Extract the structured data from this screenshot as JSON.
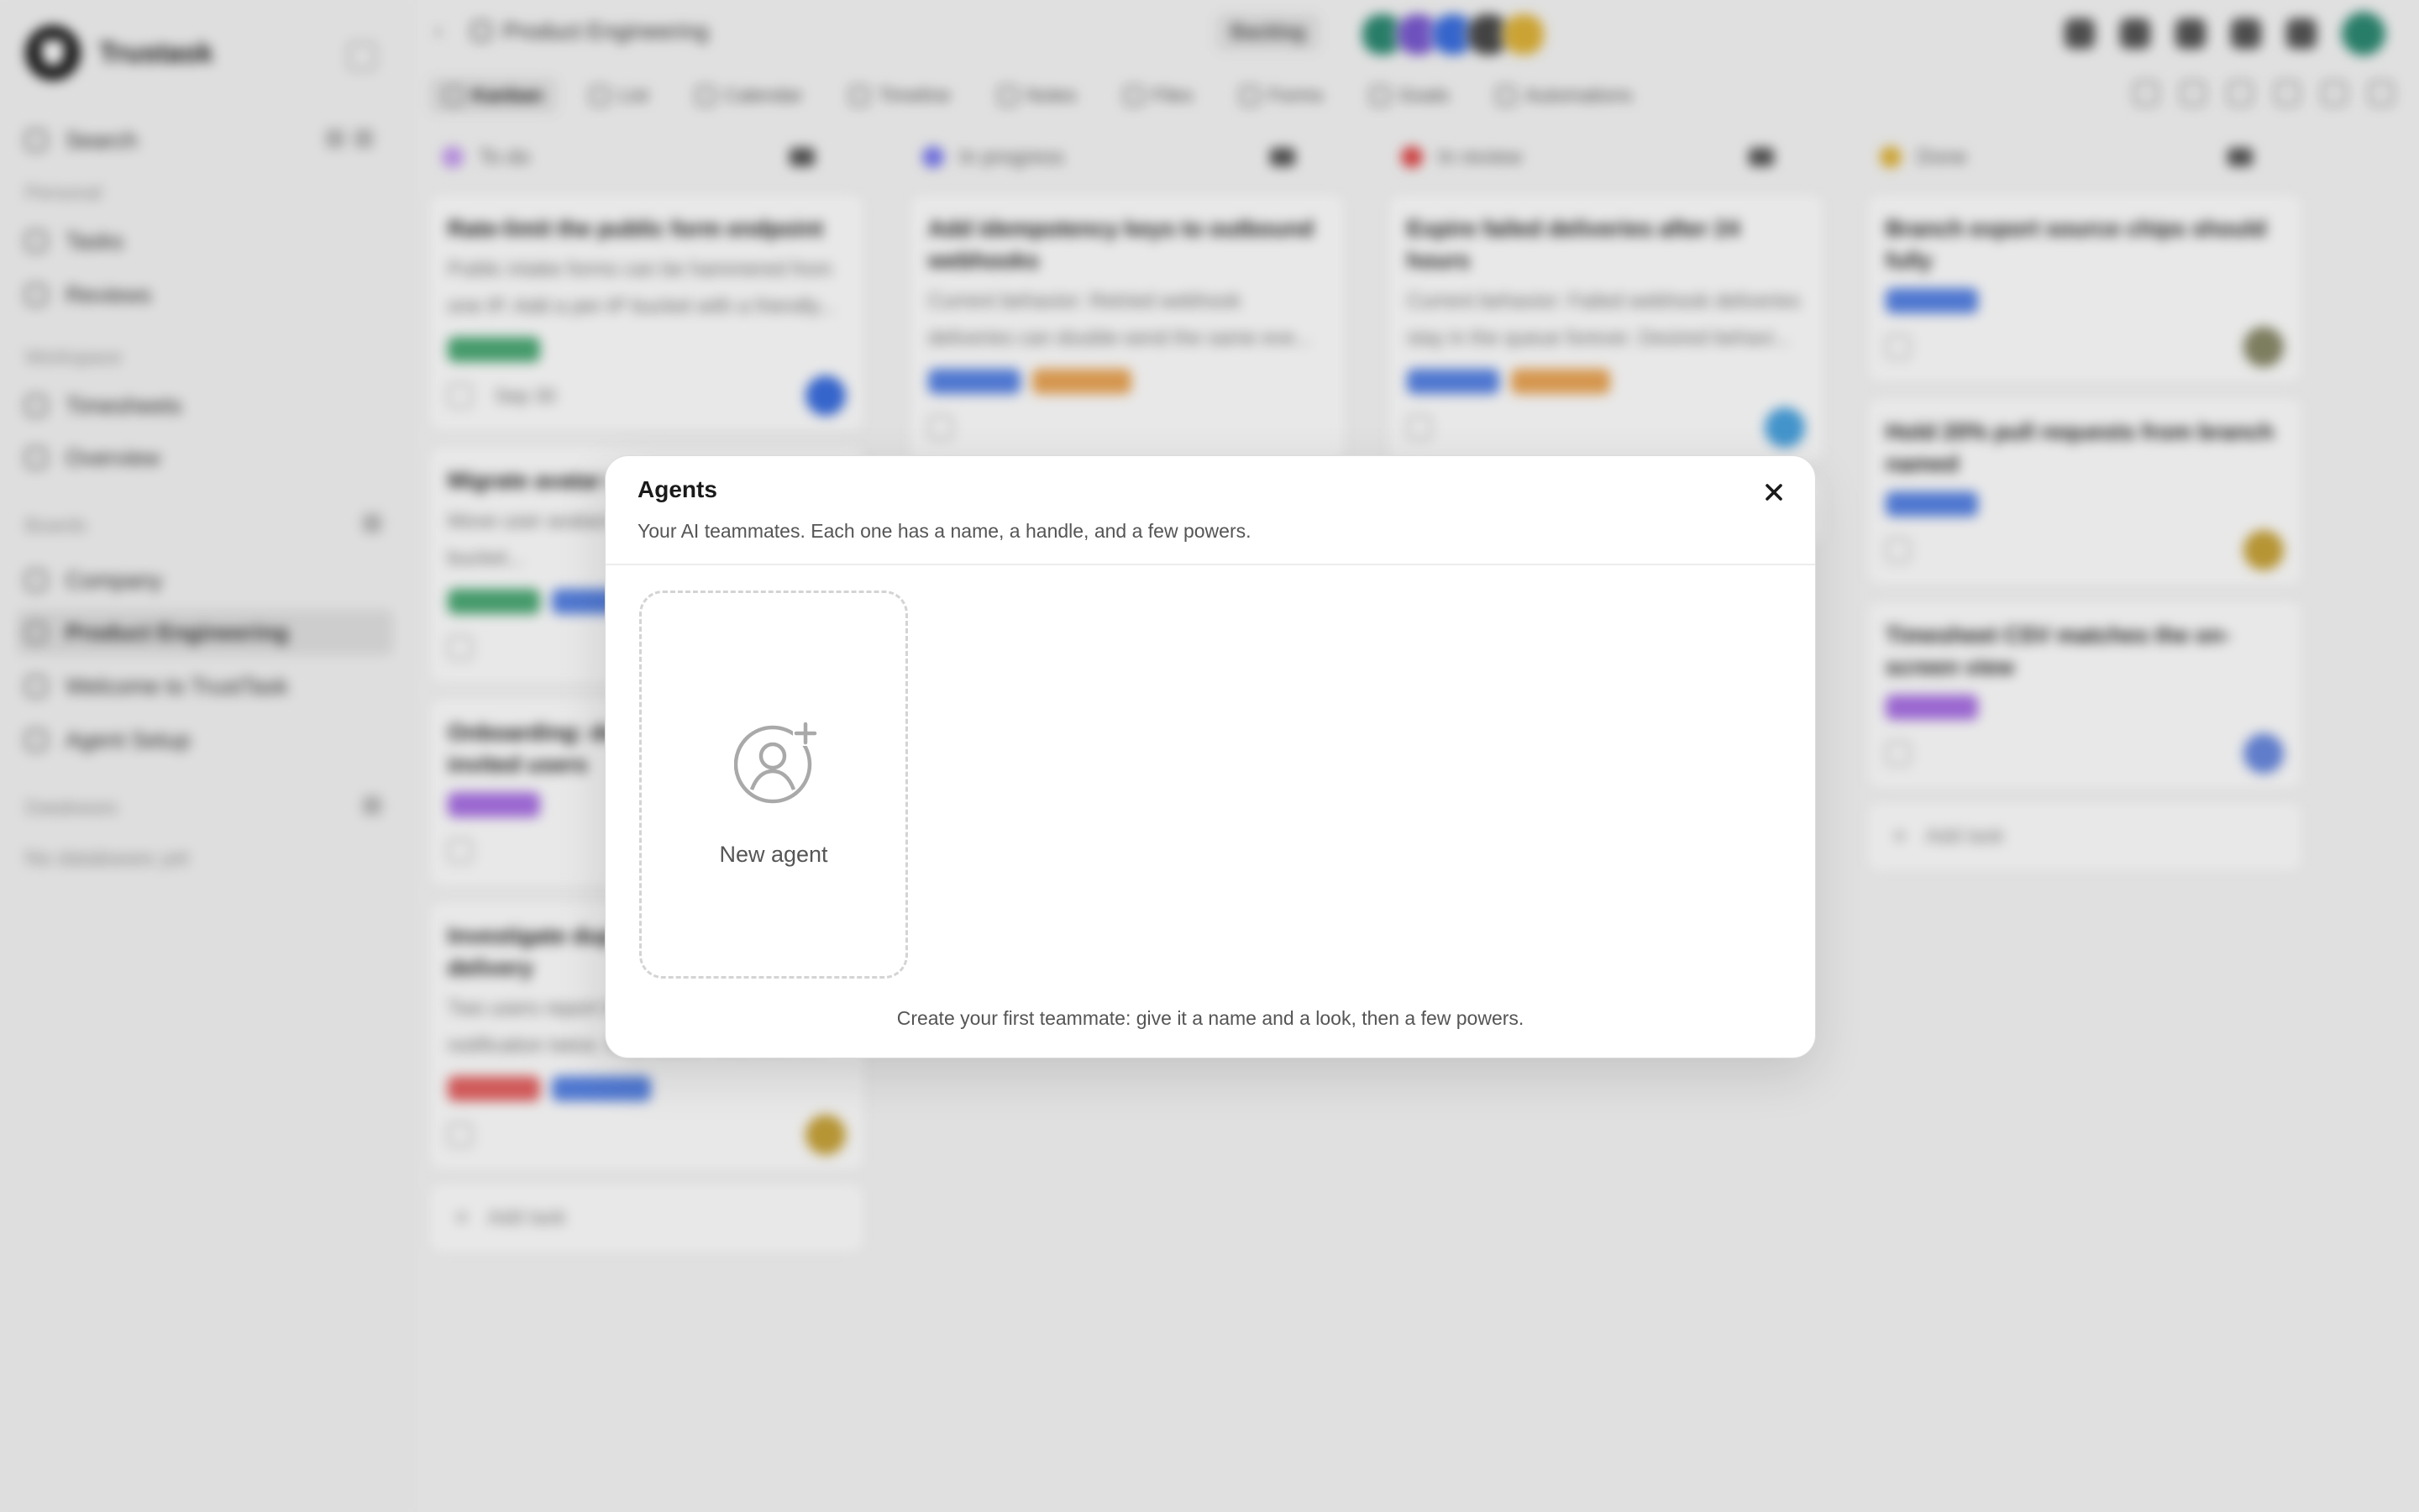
{
  "sidebar": {
    "brand": "Trustask",
    "items": [
      {
        "label": "Search"
      },
      {
        "label": "Tasks"
      },
      {
        "label": "Reviews"
      },
      {
        "label": "Timesheets"
      },
      {
        "label": "Overview"
      },
      {
        "label": "Company"
      },
      {
        "label": "Product Engineering"
      },
      {
        "label": "Welcome to TrustTask"
      },
      {
        "label": "Agent Setup"
      }
    ],
    "sections": {
      "personal": "Personal",
      "workspace": "Workspace",
      "boards": "Boards",
      "databases": "Databases"
    },
    "databases_empty": "No databases yet"
  },
  "header": {
    "breadcrumb": "Product Engineering",
    "view_pill": "Backlog"
  },
  "viewbar": {
    "tabs": [
      {
        "label": "Kanban"
      },
      {
        "label": "List"
      },
      {
        "label": "Calendar"
      },
      {
        "label": "Timeline"
      },
      {
        "label": "Notes"
      },
      {
        "label": "Files"
      },
      {
        "label": "Forms"
      },
      {
        "label": "Goals"
      },
      {
        "label": "Automations"
      }
    ]
  },
  "board": {
    "columns": [
      {
        "name": "To do",
        "color": "#c69cf0",
        "cards": [
          {
            "title": "Rate-limit the public form endpoint",
            "desc": "Public intake forms can be hammered from one IP. Add a per-IP bucket with a friendly...",
            "due": "Sep 30",
            "tags": [
              "#2e9b5e"
            ],
            "avatar": "#3b6fe0"
          },
          {
            "title": "Migrate avatar uploads",
            "desc": "Move user avatars off local disk to the S3 bucket...",
            "due": "",
            "tags": [
              "#2e9b5e",
              "#3b6fe0"
            ],
            "avatar": ""
          },
          {
            "title": "Onboarding: default workspace for invited users",
            "desc": "",
            "due": "",
            "tags": [
              "#9b59e0"
            ],
            "avatar": ""
          },
          {
            "title": "Investigate duplicate notification delivery",
            "desc": "Two users report the same mention notification twice. Reproduce first, then fi...",
            "due": "",
            "tags": [
              "#e04848",
              "#3b6fe0"
            ],
            "avatar": "#c9a43a"
          }
        ]
      },
      {
        "name": "In progress",
        "color": "#7a7af0",
        "cards": [
          {
            "title": "Add idempotency keys to outbound webhooks",
            "desc": "Current behavior: Retried webhook deliveries can double-send the same eve...",
            "due": "",
            "tags": [
              "#3b6fe0",
              "#e8963a"
            ],
            "avatar": ""
          }
        ]
      },
      {
        "name": "In review",
        "color": "#e04848",
        "cards": [
          {
            "title": "Expire failed deliveries after 24 hours",
            "desc": "Current behavior: Failed webhook deliveries stay in the queue forever. Desired behavi...",
            "due": "",
            "tags": [
              "#3b6fe0",
              "#e8963a"
            ],
            "avatar": "#4aa3e0"
          }
        ]
      },
      {
        "name": "Done",
        "color": "#e0b43a",
        "cards": [
          {
            "title": "Branch export source chips should fully",
            "desc": "",
            "due": "",
            "tags": [
              "#3b6fe0"
            ],
            "avatar": "#8a8a6a"
          },
          {
            "title": "Hold 20% pull requests from branch named",
            "desc": "",
            "due": "",
            "tags": [
              "#3b6fe0"
            ],
            "avatar": "#c9a43a"
          },
          {
            "title": "Timesheet CSV matches the on-screen view",
            "desc": "",
            "due": "",
            "tags": [
              "#9b59e0"
            ],
            "avatar": "#6a8ae0"
          }
        ]
      }
    ],
    "add_task_label": "Add task"
  },
  "dialog": {
    "title": "Agents",
    "subtitle": "Your AI teammates. Each one has a name, a handle, and a few powers.",
    "new_agent_label": "New agent",
    "footer_hint": "Create your first teammate: give it a name and a look, then a few powers.",
    "icons": {
      "close": "close-icon",
      "new_agent": "user-plus-icon"
    }
  },
  "colors": {
    "accent_avatar": "#2d8a73",
    "dashed_border": "#d4d4d4"
  }
}
